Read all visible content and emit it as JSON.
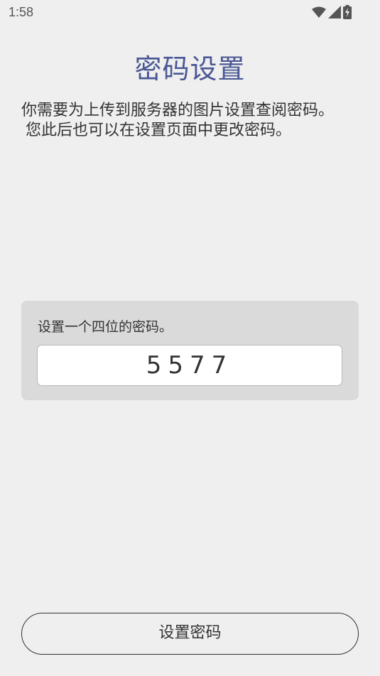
{
  "status_bar": {
    "time": "1:58",
    "icons": [
      "wifi-icon",
      "cellular-signal-icon",
      "battery-charging-icon"
    ]
  },
  "page": {
    "title": "密码设置",
    "description_line1": "你需要为上传到服务器的图片设置查阅密码。",
    "description_line2": "您此后也可以在设置页面中更改密码。"
  },
  "password_card": {
    "prompt": "设置一个四位的密码。",
    "value": "5577"
  },
  "actions": {
    "set_password_label": "设置密码"
  },
  "colors": {
    "background": "#efefef",
    "title": "#4a5794",
    "card": "#dadada",
    "text": "#333333"
  }
}
